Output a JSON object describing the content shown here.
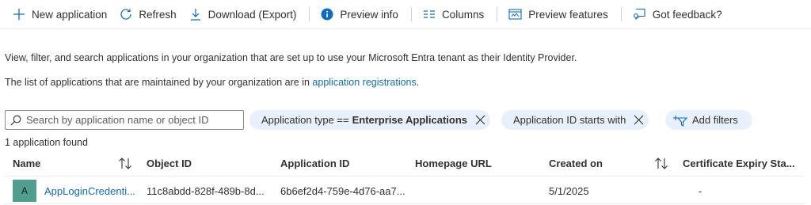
{
  "toolbar": {
    "new_application": "New application",
    "refresh": "Refresh",
    "download": "Download (Export)",
    "preview_info": "Preview info",
    "columns": "Columns",
    "preview_features": "Preview features",
    "feedback": "Got feedback?"
  },
  "description": {
    "line1": "View, filter, and search applications in your organization that are set up to use your Microsoft Entra tenant as their Identity Provider.",
    "line2_prefix": "The list of applications that are maintained by your organization are in ",
    "line2_link": "application registrations",
    "line2_suffix": "."
  },
  "search": {
    "placeholder": "Search by application name or object ID"
  },
  "filters": [
    {
      "label": "Application type ==",
      "value": "Enterprise Applications"
    },
    {
      "label": "Application ID starts with",
      "value": ""
    }
  ],
  "add_filters": "Add filters",
  "result_count": "1 application found",
  "table": {
    "columns": [
      "Name",
      "Object ID",
      "Application ID",
      "Homepage URL",
      "Created on",
      "Certificate Expiry Sta..."
    ],
    "rows": [
      {
        "avatar": "A",
        "name": "AppLoginCredenti...",
        "object_id": "11c8abdd-828f-489b-8d...",
        "application_id": "6b6ef2d4-759e-4d76-aa7...",
        "homepage_url": "",
        "created_on": "5/1/2025",
        "cert_expiry": "-"
      }
    ]
  },
  "colors": {
    "accent": "#0f6cbd",
    "pill_bg": "#e8f1fb",
    "avatar_bg": "#4f9e8e"
  }
}
